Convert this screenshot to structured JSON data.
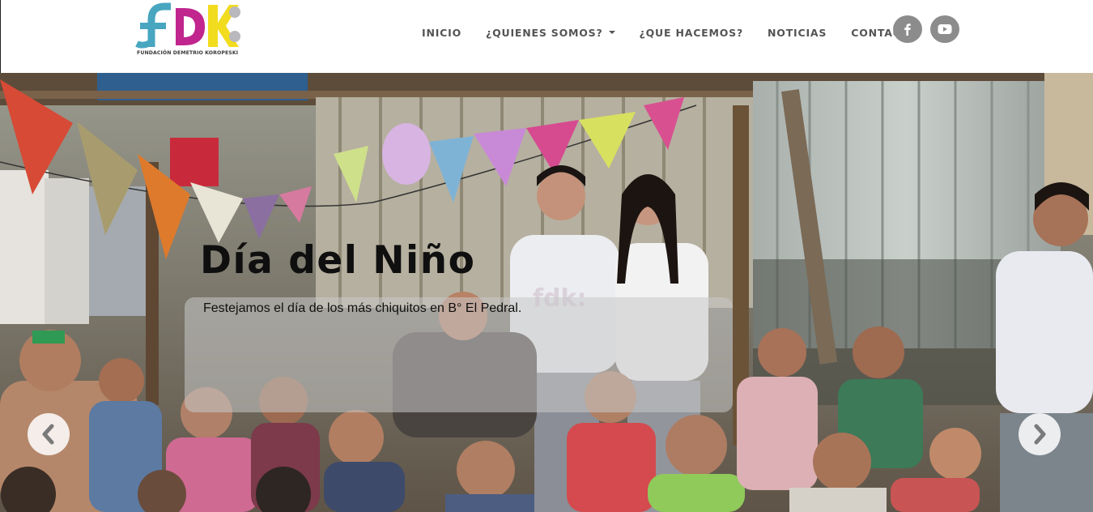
{
  "header": {
    "logo": {
      "letters": "fdk:",
      "caption": "FUNDACIÓN DEMETRIO KOROPESKI",
      "colors": {
        "f": "#48a6c0",
        "d": "#c0268e",
        "k": "#f2dc1e",
        "dots": "#b8b8bd"
      }
    },
    "nav": {
      "items": [
        {
          "label": "INICIO"
        },
        {
          "label": "¿QUIENES SOMOS?"
        },
        {
          "label": "¿QUE HACEMOS?"
        },
        {
          "label": "NOTICIAS"
        },
        {
          "label": "CONTACTO"
        }
      ]
    },
    "social": [
      {
        "icon": "facebook-icon",
        "glyph": "f"
      },
      {
        "icon": "youtube-icon",
        "glyph": "▶"
      }
    ]
  },
  "hero": {
    "title": "Día del Niño",
    "text": "Festejamos el día de los más chiquitos en B° El Pedral.",
    "prev_icon": "chevron-left-icon",
    "next_icon": "chevron-right-icon",
    "shirt_logo": "fdk:"
  },
  "colors": {
    "nav_text": "#545454",
    "social_bg": "#8c8c8c",
    "caption_bg": "rgba(200,200,200,0.55)"
  }
}
